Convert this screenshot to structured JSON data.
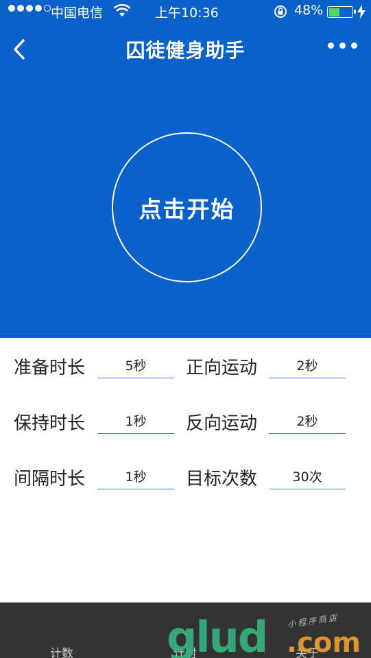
{
  "status_bar": {
    "carrier": "中国电信",
    "time": "上午10:36",
    "battery_text": "48%",
    "battery_level": 0.48
  },
  "nav": {
    "title": "囚徒健身助手"
  },
  "start_button": {
    "label": "点击开始"
  },
  "settings": {
    "prepare": {
      "label": "准备时长",
      "value": "5秒"
    },
    "forward": {
      "label": "正向运动",
      "value": "2秒"
    },
    "hold": {
      "label": "保持时长",
      "value": "1秒"
    },
    "reverse": {
      "label": "反向运动",
      "value": "2秒"
    },
    "interval": {
      "label": "间隔时长",
      "value": "1秒"
    },
    "target": {
      "label": "目标次数",
      "value": "30次"
    }
  },
  "tab_bar": {
    "tabs": [
      {
        "label": "计数"
      },
      {
        "label": "计时"
      },
      {
        "label": "关于"
      }
    ]
  },
  "watermark": {
    "logo": "glud",
    "suffix": ".com",
    "tagline": "小程序商店"
  },
  "colors": {
    "primary": "#0a61c9",
    "underline": "#2b7be0",
    "tab_bar": "#333333"
  }
}
